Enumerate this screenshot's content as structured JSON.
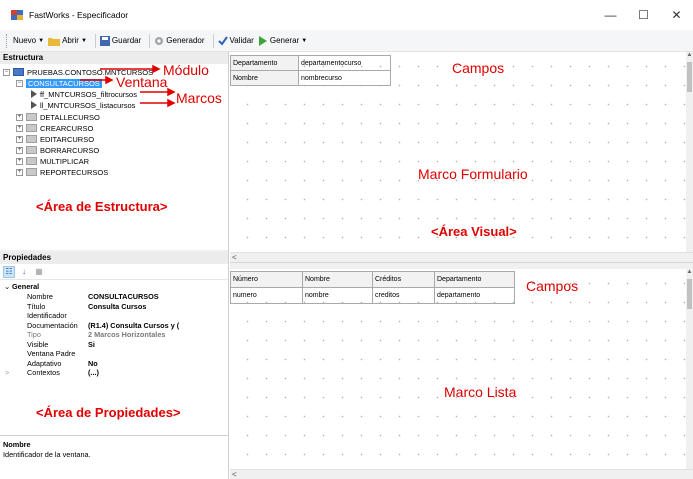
{
  "window": {
    "title": "FastWorks - Especificador",
    "minimize": "—",
    "maximize": "☐",
    "close": "✕"
  },
  "toolbar": {
    "nuevo": "Nuevo",
    "abrir": "Abrir",
    "guardar": "Guardar",
    "generador": "Generador",
    "validar": "Validar",
    "generar": "Generar"
  },
  "structure": {
    "header": "Estructura",
    "module": "PRUEBAS.CONTOSO.MNTCURSOS",
    "selected_window": "CONSULTACURSOS",
    "frames": [
      "ff_MNTCURSOS_filtrocursos",
      "ll_MNTCURSOS_listacursos"
    ],
    "windows": [
      "DETALLECURSO",
      "CREARCURSO",
      "EDITARCURSO",
      "BORRARCURSO",
      "MULTIPLICAR",
      "REPORTECURSOS"
    ]
  },
  "annotations": {
    "modulo": "Módulo",
    "ventana": "Ventana",
    "marcos": "Marcos",
    "area_estructura": "<Área de Estructura>",
    "area_propiedades": "<Área de Propiedades>",
    "campos_top": "Campos",
    "marco_formulario": "Marco Formulario",
    "area_visual": "<Área Visual>",
    "campos_bottom": "Campos",
    "marco_lista": "Marco Lista"
  },
  "properties": {
    "header": "Propiedades",
    "group": "General",
    "rows": [
      {
        "name": "Nombre",
        "value": "CONSULTACURSOS"
      },
      {
        "name": "Título",
        "value": "Consulta Cursos"
      },
      {
        "name": "Identificador",
        "value": ""
      },
      {
        "name": "Documentación",
        "value": "(R1.4) Consulta Cursos y ("
      },
      {
        "name": "Tipo",
        "value": "2 Marcos Horizontales"
      },
      {
        "name": "Visible",
        "value": "Si"
      },
      {
        "name": "Ventana Padre",
        "value": ""
      },
      {
        "name": "Adaptativo",
        "value": "No"
      },
      {
        "name": "Contextos",
        "value": "(...)"
      }
    ],
    "description_title": "Nombre",
    "description_text": "Identificador de la ventana."
  },
  "form_frame": {
    "fields": [
      {
        "label": "Departamento",
        "value": "departamentocurso"
      },
      {
        "label": "Nombre",
        "value": "nombrecurso"
      }
    ]
  },
  "list_frame": {
    "headers": [
      "Número",
      "Nombre",
      "Créditos",
      "Departamento"
    ],
    "row": [
      "numero",
      "nombre",
      "creditos",
      "departamento"
    ]
  }
}
